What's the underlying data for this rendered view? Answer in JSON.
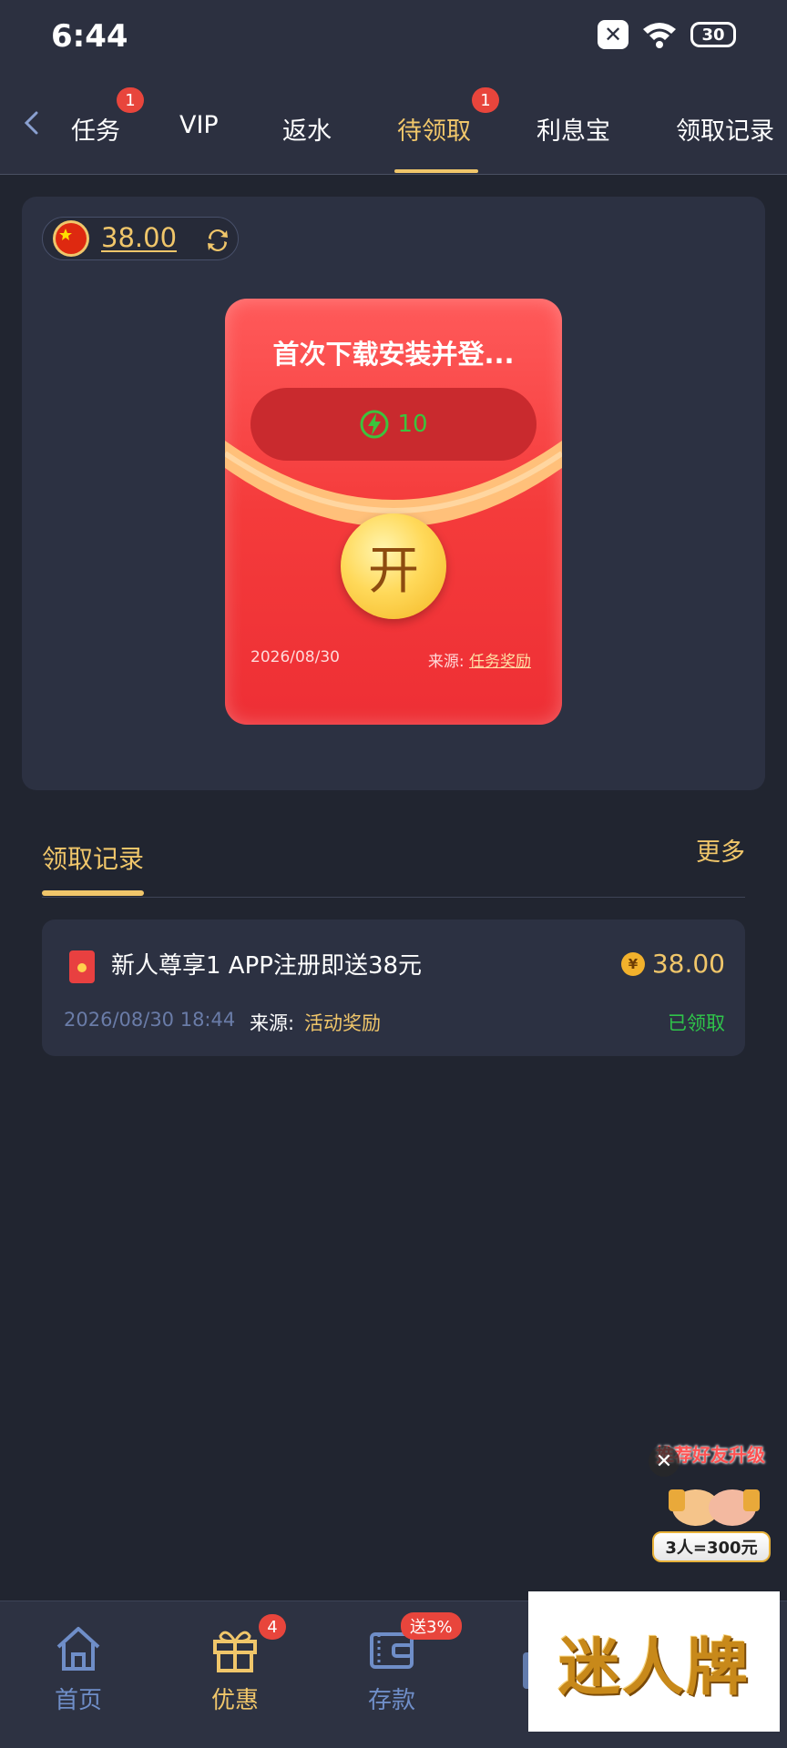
{
  "status_bar": {
    "time": "6:44",
    "battery": "30"
  },
  "tabs": [
    {
      "label": "任务",
      "badge": "1"
    },
    {
      "label": "VIP"
    },
    {
      "label": "返水"
    },
    {
      "label": "待领取",
      "badge": "1",
      "active": true
    },
    {
      "label": "利息宝"
    },
    {
      "label": "领取记录"
    }
  ],
  "balance": {
    "amount": "38.00"
  },
  "red_packet": {
    "title": "首次下载安装并登...",
    "energy": "10",
    "open_label": "开",
    "date": "2026/08/30",
    "source_label": "来源:",
    "source": "任务奖励"
  },
  "records_section": {
    "title": "领取记录",
    "more": "更多"
  },
  "records": [
    {
      "name": "新人尊享1  APP注册即送38元",
      "currency_symbol": "¥",
      "amount": "38.00",
      "time": "2026/08/30 18:44",
      "source_label": "来源:",
      "source": "活动奖励",
      "status": "已领取"
    }
  ],
  "promo": {
    "top_text": "推荐好友升级",
    "close": "✕",
    "badge": "3人=300元"
  },
  "bottom_nav": [
    {
      "label": "首页"
    },
    {
      "label": "优惠",
      "badge": "4"
    },
    {
      "label": "存款",
      "badge": "送3%"
    }
  ],
  "watermark": "迷人牌",
  "colors": {
    "accent": "#f0c66a",
    "background": "#212530",
    "card": "#2c3142",
    "success": "#2fc44a",
    "badge": "#e8453c"
  }
}
